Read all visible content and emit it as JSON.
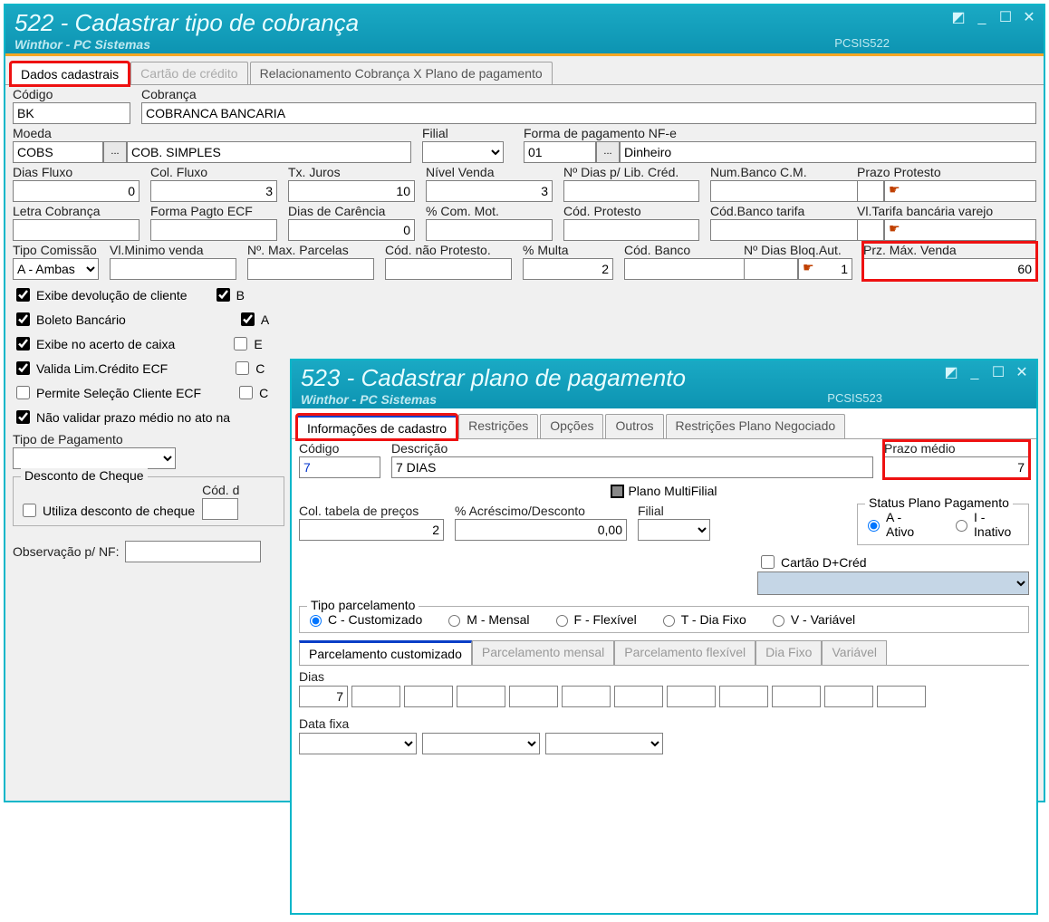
{
  "w522": {
    "title": "522 - Cadastrar tipo de cobrança",
    "subtitle": "Winthor - PC Sistemas",
    "pcs": "PCSIS522",
    "tabs": {
      "dados": "Dados cadastrais",
      "cartao": "Cartão de crédito",
      "rel": "Relacionamento Cobrança X Plano de pagamento"
    },
    "labels": {
      "codigo": "Código",
      "cobranca": "Cobrança",
      "moeda": "Moeda",
      "filial": "Filial",
      "formaPagNFe": "Forma de pagamento NF-e",
      "diasFluxo": "Dias Fluxo",
      "colFluxo": "Col. Fluxo",
      "txJuros": "Tx. Juros",
      "nivelVenda": "Nível Venda",
      "nDiasLib": "Nº Dias p/ Lib. Créd.",
      "numBancoCM": "Num.Banco C.M.",
      "prazoProtesto": "Prazo Protesto",
      "letraCob": "Letra Cobrança",
      "formaPagtoECF": "Forma Pagto ECF",
      "diasCarencia": "Dias de Carência",
      "pctComMot": "% Com. Mot.",
      "codProtesto": "Cód. Protesto",
      "codBancoTarifa": "Cód.Banco tarifa",
      "vlTarifaVarejo": "Vl.Tarifa bancária varejo",
      "tipoComissao": "Tipo Comissão",
      "vlMinVenda": "Vl.Minimo venda",
      "nMaxParc": "Nº. Max. Parcelas",
      "codNaoProt": "Cód. não Protesto.",
      "pctMulta": "% Multa",
      "codBanco": "Cód. Banco",
      "nDiasBloq": "Nº Dias Bloq.Aut.",
      "przMaxVenda": "Prz. Máx. Venda",
      "tipoPagamento": "Tipo de Pagamento",
      "descCheque": "Desconto de Cheque",
      "utilizaDescCheque": "Utiliza desconto de cheque",
      "codD": "Cód. d",
      "obsNF": "Observação p/ NF:"
    },
    "values": {
      "codigo": "BK",
      "cobranca": "COBRANCA BANCARIA",
      "moeda": "COBS",
      "moedaDesc": "COB. SIMPLES",
      "filial": "",
      "formaPagNFeCod": "01",
      "formaPagNFeDesc": "Dinheiro",
      "diasFluxo": "0",
      "colFluxo": "3",
      "txJuros": "10",
      "nivelVenda": "3",
      "nDiasLib": "",
      "numBancoCM": "",
      "prazoProtesto": "",
      "letraCob": "",
      "formaPagtoECF": "",
      "diasCarencia": "0",
      "pctComMot": "",
      "codProtesto": "",
      "codBancoTarifa": "",
      "vlTarifaVarejo": "",
      "tipoComissao": "A - Ambas",
      "vlMinVenda": "",
      "nMaxParc": "",
      "codNaoProt": "",
      "pctMulta": "2",
      "codBanco": "",
      "nDiasBloq": "1",
      "przMaxVenda": "60"
    },
    "checks": {
      "exibeDev": "Exibe devolução de cliente",
      "boleto": "Boleto Bancário",
      "exibeAcerto": "Exibe no acerto de caixa",
      "validaLim": "Valida Lim.Crédito ECF",
      "permiteSel": "Permite Seleção Cliente ECF",
      "naoValidarPrazo": "Não validar prazo médio no ato na",
      "b": "B",
      "a": "A",
      "e": "E",
      "c": "C",
      "c2": "C"
    }
  },
  "w523": {
    "title": "523 - Cadastrar plano de pagamento",
    "subtitle": "Winthor - PC Sistemas",
    "pcs": "PCSIS523",
    "tabs": {
      "info": "Informações de cadastro",
      "restr": "Restrições",
      "opc": "Opções",
      "outros": "Outros",
      "restrPlano": "Restrições Plano Negociado"
    },
    "labels": {
      "codigo": "Código",
      "descricao": "Descrição",
      "prazoMedio": "Prazo médio",
      "planoMulti": "Plano MultiFilial",
      "colTabela": "Col. tabela de preços",
      "pctAcresc": "% Acréscimo/Desconto",
      "filial": "Filial",
      "statusPlano": "Status Plano Pagamento",
      "ativo": "A - Ativo",
      "inativo": "I - Inativo",
      "cartaoDCred": "Cartão D+Créd",
      "tipoParc": "Tipo parcelamento",
      "tpC": "C - Customizado",
      "tpM": "M - Mensal",
      "tpF": "F - Flexível",
      "tpT": "T - Dia Fixo",
      "tpV": "V - Variável",
      "parcCust": "Parcelamento customizado",
      "parcMens": "Parcelamento mensal",
      "parcFlex": "Parcelamento flexível",
      "diaFixo": "Dia Fixo",
      "variavel": "Variável",
      "dias": "Dias",
      "dataFixa": "Data fixa"
    },
    "values": {
      "codigo": "7",
      "descricao": "7 DIAS",
      "prazoMedio": "7",
      "colTabela": "2",
      "pctAcresc": "0,00",
      "dias1": "7"
    }
  }
}
